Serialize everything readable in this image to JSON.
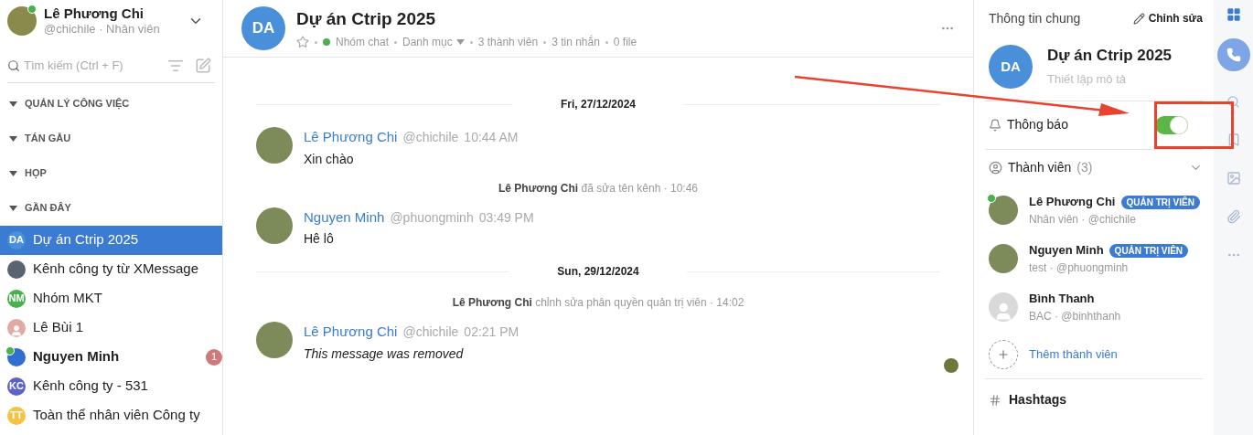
{
  "user": {
    "name": "Lê Phương Chi",
    "subtitle": "@chichile · Nhân viên",
    "online": true
  },
  "search": {
    "placeholder": "Tìm kiếm (Ctrl + F)"
  },
  "sections": [
    {
      "label": "QUẢN LÝ CÔNG VIỆC",
      "expanded": true
    },
    {
      "label": "TÁN GẪU",
      "expanded": true
    },
    {
      "label": "HỌP",
      "expanded": true
    },
    {
      "label": "GẦN ĐÂY",
      "expanded": true
    }
  ],
  "recent": [
    {
      "kind": "initials",
      "initials": "DA",
      "name": "Dự án Ctrip 2025",
      "selected": true,
      "color": "#4a8fd9",
      "online": false,
      "unread": false
    },
    {
      "kind": "photo",
      "name": "Kênh công ty từ XMessage",
      "selected": false,
      "color": "#5a6470",
      "online": false,
      "unread": false
    },
    {
      "kind": "initials",
      "initials": "NM",
      "name": "Nhóm MKT",
      "selected": false,
      "color": "#4caf50",
      "online": false,
      "unread": false
    },
    {
      "kind": "person",
      "name": "Lê Bùi 1",
      "selected": false,
      "color": "#e0aaa5",
      "online": false,
      "unread": false
    },
    {
      "kind": "photo",
      "name": "Nguyen Minh",
      "selected": false,
      "color": "#2f6fd0",
      "online": true,
      "unread": true,
      "badge": "1"
    },
    {
      "kind": "initials",
      "initials": "KC",
      "name": "Kênh công ty - 531",
      "selected": false,
      "color": "#5b63c9",
      "online": false,
      "unread": false
    },
    {
      "kind": "initials",
      "initials": "TT",
      "name": "Toàn thể nhân viên Công ty",
      "selected": false,
      "color": "#f5c242",
      "online": false,
      "unread": false
    }
  ],
  "channel": {
    "initials": "DA",
    "title": "Dự án Ctrip 2025",
    "starred": false,
    "type": "Nhóm chat",
    "category": "Danh mục",
    "members": "3 thành viên",
    "messages": "3 tin nhắn",
    "files": "0 file"
  },
  "timeline": [
    {
      "kind": "date",
      "text": "Fri, 27/12/2024"
    },
    {
      "kind": "message",
      "author": "Lê Phương Chi",
      "handle": "@chichile",
      "time": "10:44 AM",
      "text": "Xin chào",
      "removed": false
    },
    {
      "kind": "event",
      "actor": "Lê Phương Chi",
      "text": "đã sửa tên kênh · 10:46"
    },
    {
      "kind": "message",
      "author": "Nguyen Minh",
      "handle": "@phuongminh",
      "time": "03:49 PM",
      "text": "Hê lô",
      "removed": false
    },
    {
      "kind": "date",
      "text": "Sun, 29/12/2024"
    },
    {
      "kind": "event",
      "actor": "Lê Phương Chi",
      "text": "chỉnh sửa phân quyền quản trị viên · 14:02"
    },
    {
      "kind": "message",
      "author": "Lê Phương Chi",
      "handle": "@chichile",
      "time": "02:21 PM",
      "text": "This message was removed",
      "removed": true
    }
  ],
  "info": {
    "heading": "Thông tin chung",
    "edit": "Chỉnh sửa",
    "initials": "DA",
    "title": "Dự án Ctrip 2025",
    "description_placeholder": "Thiết lập mô tả",
    "notify_label": "Thông báo",
    "notify_on": true,
    "members_label": "Thành viên",
    "members_count": "(3)",
    "add_member": "Thêm thành viên",
    "hashtags": "Hashtags"
  },
  "members": [
    {
      "kind": "photo",
      "name": "Lê Phương Chi",
      "role_badge": "QUẢN TRỊ VIÊN",
      "detail": "Nhân viên · @chichile",
      "online": true
    },
    {
      "kind": "photo",
      "name": "Nguyen Minh",
      "role_badge": "QUẢN TRỊ VIÊN",
      "detail": "test · @phuongminh",
      "online": false
    },
    {
      "kind": "person",
      "name": "Bình Thanh",
      "detail": "BAC · @binhthanh",
      "online": false
    }
  ]
}
